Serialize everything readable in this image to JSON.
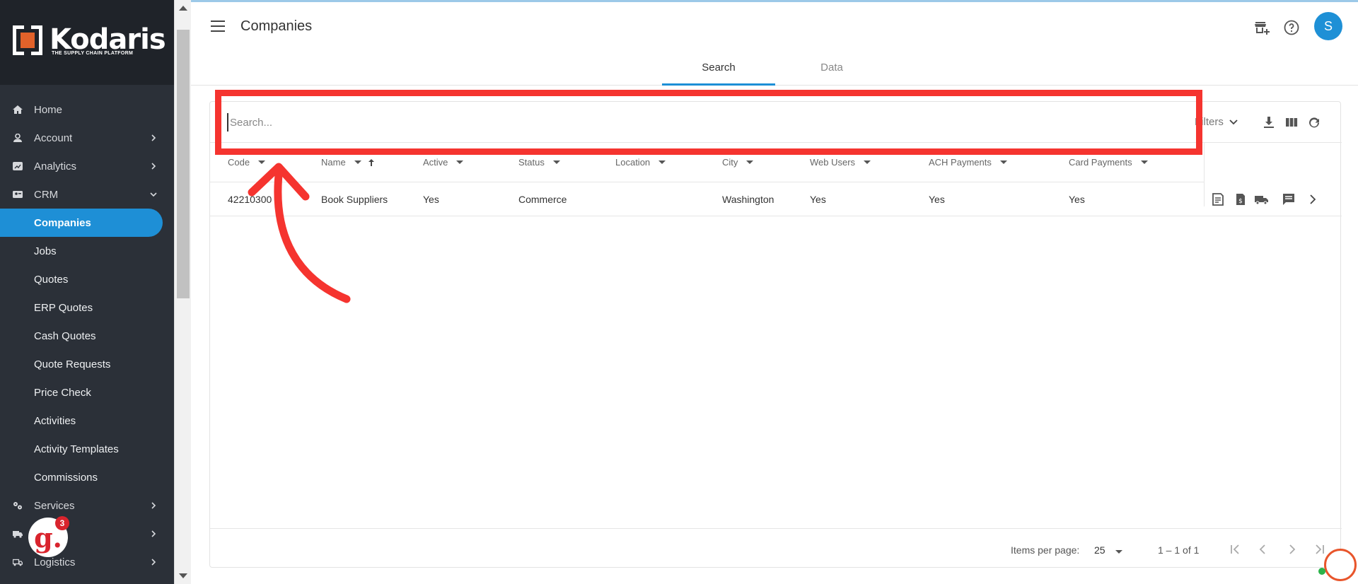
{
  "brand": {
    "name": "Kodaris",
    "tagline": "THE SUPPLY CHAIN PLATFORM",
    "accent": "#1e8fd6",
    "sidebar_bg": "#2b3038"
  },
  "sidebar": {
    "items": [
      {
        "label": "Home",
        "icon": "home-icon",
        "expandable": false
      },
      {
        "label": "Account",
        "icon": "person-icon",
        "expandable": true
      },
      {
        "label": "Analytics",
        "icon": "chart-icon",
        "expandable": true
      },
      {
        "label": "CRM",
        "icon": "contacts-icon",
        "expandable": true,
        "expanded": true
      }
    ],
    "crm_children": [
      {
        "label": "Companies",
        "active": true
      },
      {
        "label": "Jobs"
      },
      {
        "label": "Quotes"
      },
      {
        "label": "ERP Quotes"
      },
      {
        "label": "Cash Quotes"
      },
      {
        "label": "Quote Requests"
      },
      {
        "label": "Price Check"
      },
      {
        "label": "Activities"
      },
      {
        "label": "Activity Templates"
      },
      {
        "label": "Commissions"
      }
    ],
    "bottom_items": [
      {
        "label": "Services",
        "icon": "gears-icon",
        "expandable": true
      },
      {
        "label": "",
        "icon": "truck-icon",
        "expandable": true
      },
      {
        "label": "Logistics",
        "icon": "shipping-icon",
        "expandable": true
      }
    ],
    "grammarly_count": "3"
  },
  "header": {
    "title": "Companies",
    "avatar_initial": "S"
  },
  "tabs": [
    {
      "label": "Search",
      "active": true
    },
    {
      "label": "Data",
      "active": false
    }
  ],
  "search": {
    "placeholder": "Search...",
    "value": "",
    "filters_label": "Filters"
  },
  "table": {
    "columns": [
      "Code",
      "Name",
      "Active",
      "Status",
      "Location",
      "City",
      "Web Users",
      "ACH Payments",
      "Card Payments"
    ],
    "rows": [
      {
        "code": "42210300",
        "name": "Book Suppliers",
        "active": "Yes",
        "status": "Commerce",
        "location": "",
        "city": "Washington",
        "web_users": "Yes",
        "ach_payments": "Yes",
        "card_payments": "Yes"
      }
    ]
  },
  "pagination": {
    "items_per_page_label": "Items per page:",
    "page_size": "25",
    "range": "1 – 1 of 1"
  }
}
